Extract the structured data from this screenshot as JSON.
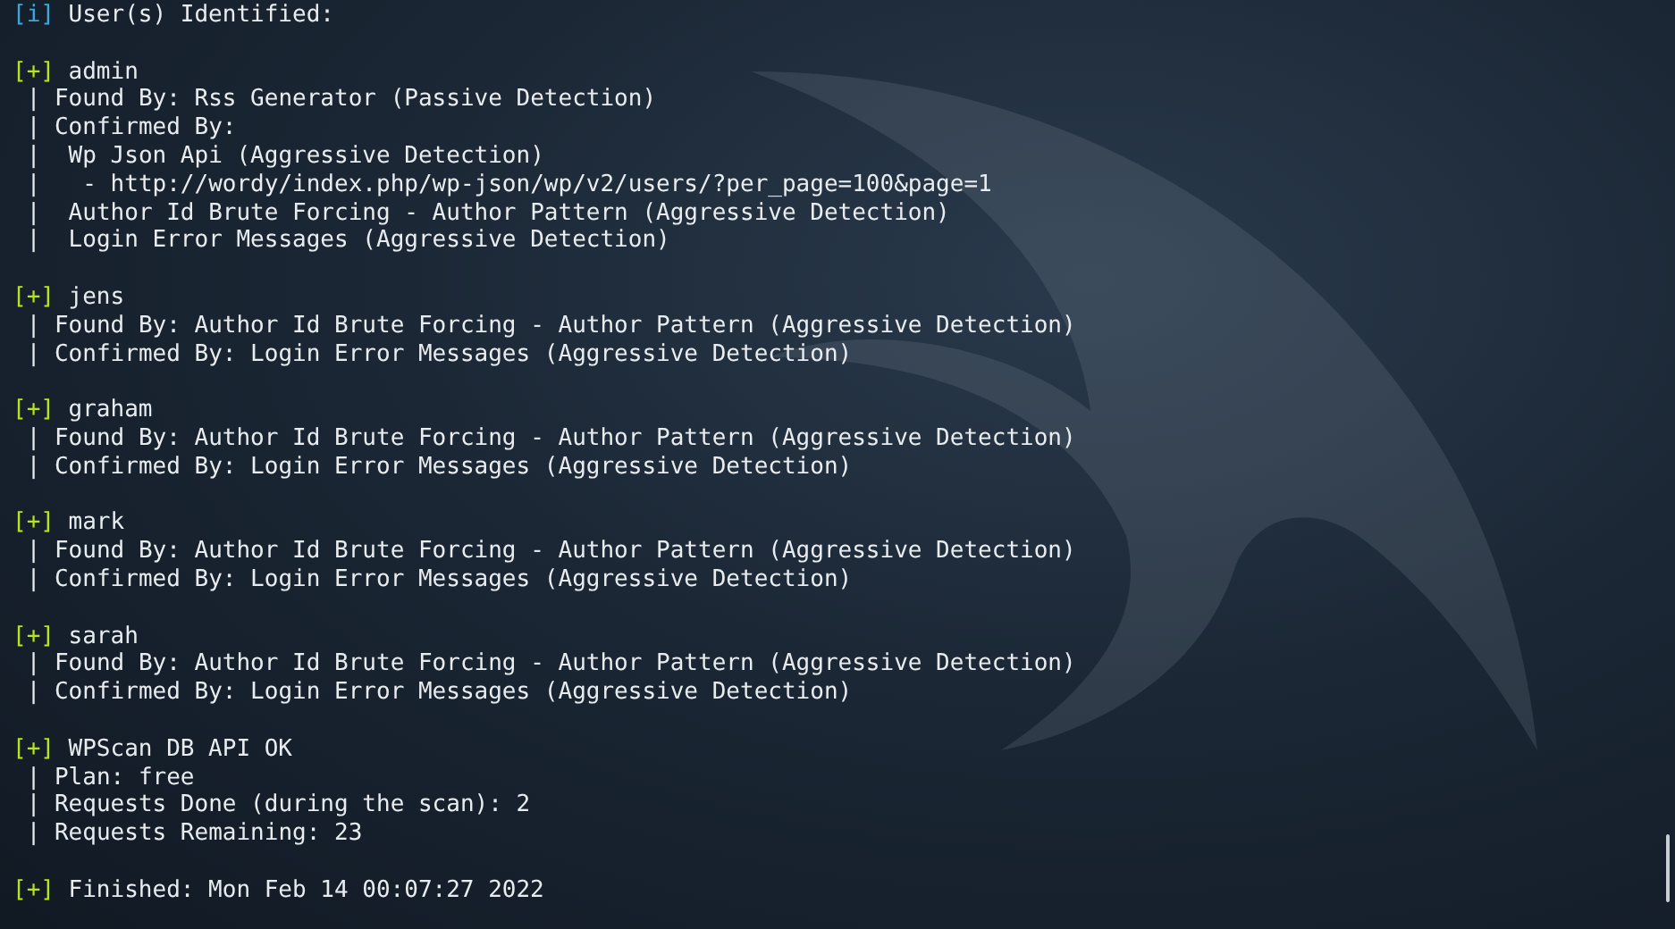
{
  "terminal": {
    "lines": [
      {
        "kind": "tagged",
        "tag": "[i]",
        "color": "#3fa7d6",
        "text": "User(s) Identified:"
      },
      {
        "kind": "blank"
      },
      {
        "kind": "tagged",
        "tag": "[+]",
        "color": "#b5e61d",
        "text": "admin"
      },
      {
        "kind": "plain",
        "text": " | Found By: Rss Generator (Passive Detection)"
      },
      {
        "kind": "plain",
        "text": " | Confirmed By:"
      },
      {
        "kind": "plain",
        "text": " |  Wp Json Api (Aggressive Detection)"
      },
      {
        "kind": "plain",
        "text": " |   - http://wordy/index.php/wp-json/wp/v2/users/?per_page=100&page=1"
      },
      {
        "kind": "plain",
        "text": " |  Author Id Brute Forcing - Author Pattern (Aggressive Detection)"
      },
      {
        "kind": "plain",
        "text": " |  Login Error Messages (Aggressive Detection)"
      },
      {
        "kind": "blank"
      },
      {
        "kind": "tagged",
        "tag": "[+]",
        "color": "#b5e61d",
        "text": "jens"
      },
      {
        "kind": "plain",
        "text": " | Found By: Author Id Brute Forcing - Author Pattern (Aggressive Detection)"
      },
      {
        "kind": "plain",
        "text": " | Confirmed By: Login Error Messages (Aggressive Detection)"
      },
      {
        "kind": "blank"
      },
      {
        "kind": "tagged",
        "tag": "[+]",
        "color": "#b5e61d",
        "text": "graham"
      },
      {
        "kind": "plain",
        "text": " | Found By: Author Id Brute Forcing - Author Pattern (Aggressive Detection)"
      },
      {
        "kind": "plain",
        "text": " | Confirmed By: Login Error Messages (Aggressive Detection)"
      },
      {
        "kind": "blank"
      },
      {
        "kind": "tagged",
        "tag": "[+]",
        "color": "#b5e61d",
        "text": "mark"
      },
      {
        "kind": "plain",
        "text": " | Found By: Author Id Brute Forcing - Author Pattern (Aggressive Detection)"
      },
      {
        "kind": "plain",
        "text": " | Confirmed By: Login Error Messages (Aggressive Detection)"
      },
      {
        "kind": "blank"
      },
      {
        "kind": "tagged",
        "tag": "[+]",
        "color": "#b5e61d",
        "text": "sarah"
      },
      {
        "kind": "plain",
        "text": " | Found By: Author Id Brute Forcing - Author Pattern (Aggressive Detection)"
      },
      {
        "kind": "plain",
        "text": " | Confirmed By: Login Error Messages (Aggressive Detection)"
      },
      {
        "kind": "blank"
      },
      {
        "kind": "tagged",
        "tag": "[+]",
        "color": "#b5e61d",
        "text": "WPScan DB API OK"
      },
      {
        "kind": "plain",
        "text": " | Plan: free"
      },
      {
        "kind": "plain",
        "text": " | Requests Done (during the scan): 2"
      },
      {
        "kind": "plain",
        "text": " | Requests Remaining: 23"
      },
      {
        "kind": "blank"
      },
      {
        "kind": "tagged",
        "tag": "[+]",
        "color": "#b5e61d",
        "text": "Finished: Mon Feb 14 00:07:27 2022"
      }
    ]
  }
}
